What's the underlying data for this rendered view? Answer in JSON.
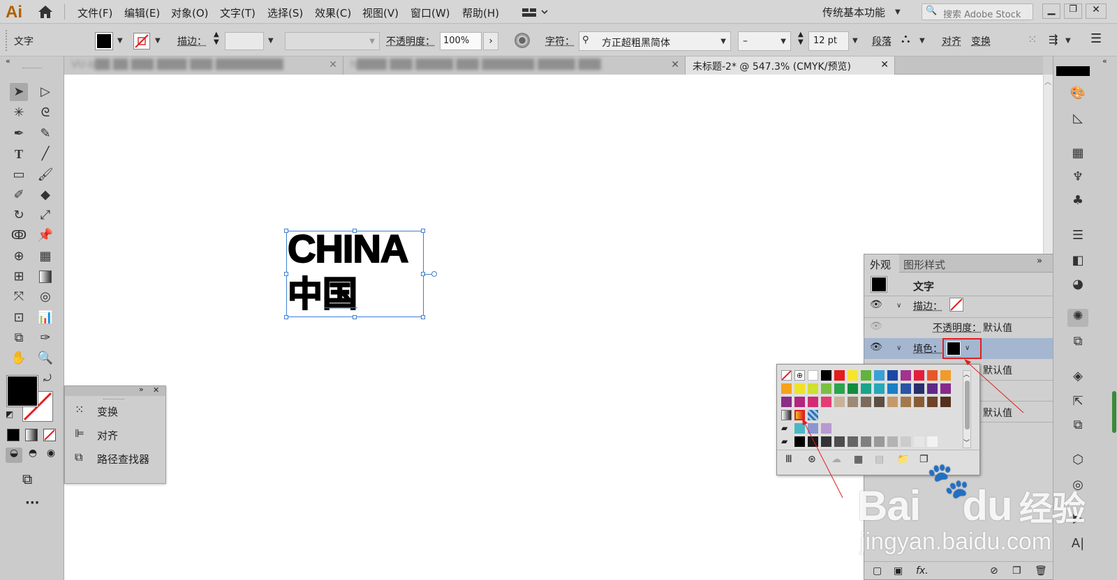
{
  "app": {
    "logo": "Ai",
    "workspace": "传统基本功能",
    "search_placeholder": "搜索 Adobe Stock"
  },
  "menus": [
    "文件(F)",
    "编辑(E)",
    "对象(O)",
    "文字(T)",
    "选择(S)",
    "效果(C)",
    "视图(V)",
    "窗口(W)",
    "帮助(H)"
  ],
  "control": {
    "selection_type": "文字",
    "stroke_label": "描边：",
    "opacity_label": "不透明度：",
    "opacity_value": "100%",
    "char_label": "字符：",
    "font_family": "方正超粗黑简体",
    "font_style": "–",
    "font_size": "12 pt",
    "paragraph_label": "段落",
    "align_label": "对齐",
    "transform_label": "变换"
  },
  "tabs": [
    {
      "label": "VU-b██ ██ ███ ████ ███ █████████"
    },
    {
      "label": "h████ ███ █████ ███ ███████ █████ ███"
    },
    {
      "label": "未标题-2* @ 547.3% (CMYK/预览)",
      "active": true
    }
  ],
  "canvas_text": {
    "line1": "CHINA",
    "line2": "中国"
  },
  "mini_panel": {
    "items": [
      "变换",
      "对齐",
      "路径查找器"
    ]
  },
  "appearance": {
    "tabs": [
      "外观",
      "图形样式"
    ],
    "title": "文字",
    "stroke_label": "描边：",
    "opacity_label": "不透明度：",
    "opacity_value": "默认值",
    "fill_label": "填色：",
    "rows_after": [
      "默认值",
      "默认值"
    ]
  },
  "watermark": {
    "brand": "Bai",
    "brand2": "du",
    "suffix": "经验",
    "url": "jingyan.baidu.com"
  },
  "colors": {
    "accent_red": "#e02020",
    "selection_blue": "#3f7fd0",
    "row_highlight": "#a4b6d0"
  }
}
